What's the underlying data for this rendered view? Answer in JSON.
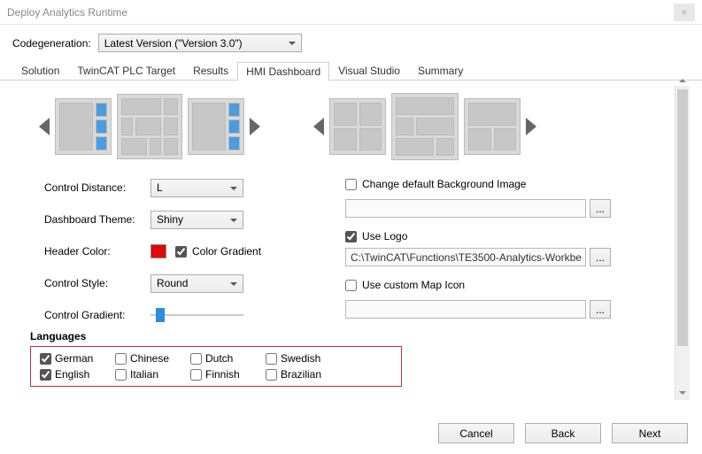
{
  "window": {
    "title": "Deploy Analytics Runtime"
  },
  "codegen": {
    "label": "Codegeneration:",
    "value": "Latest Version (\"Version 3.0\")"
  },
  "tabs": {
    "solution": "Solution",
    "plc": "TwinCAT PLC Target",
    "results": "Results",
    "hmi": "HMI Dashboard",
    "vs": "Visual Studio",
    "summary": "Summary"
  },
  "left": {
    "control_distance": {
      "label": "Control Distance:",
      "value": "L"
    },
    "theme": {
      "label": "Dashboard Theme:",
      "value": "Shiny"
    },
    "header_color": {
      "label": "Header Color:",
      "gradient_label": "Color Gradient",
      "gradient_checked": true
    },
    "control_style": {
      "label": "Control Style:",
      "value": "Round"
    },
    "control_gradient": {
      "label": "Control Gradient:"
    }
  },
  "right": {
    "change_bg": {
      "label": "Change default Background Image",
      "checked": false,
      "path": ""
    },
    "use_logo": {
      "label": "Use Logo",
      "checked": true,
      "path": "C:\\TwinCAT\\Functions\\TE3500-Analytics-Workbe"
    },
    "map_icon": {
      "label": "Use custom Map Icon",
      "checked": false,
      "path": ""
    },
    "browse": "..."
  },
  "languages": {
    "title": "Languages",
    "items": [
      {
        "label": "German",
        "checked": true
      },
      {
        "label": "Chinese",
        "checked": false
      },
      {
        "label": "Dutch",
        "checked": false
      },
      {
        "label": "Swedish",
        "checked": false
      },
      {
        "label": "English",
        "checked": true
      },
      {
        "label": "Italian",
        "checked": false
      },
      {
        "label": "Finnish",
        "checked": false
      },
      {
        "label": "Brazilian",
        "checked": false
      }
    ]
  },
  "footer": {
    "cancel": "Cancel",
    "back": "Back",
    "next": "Next"
  }
}
